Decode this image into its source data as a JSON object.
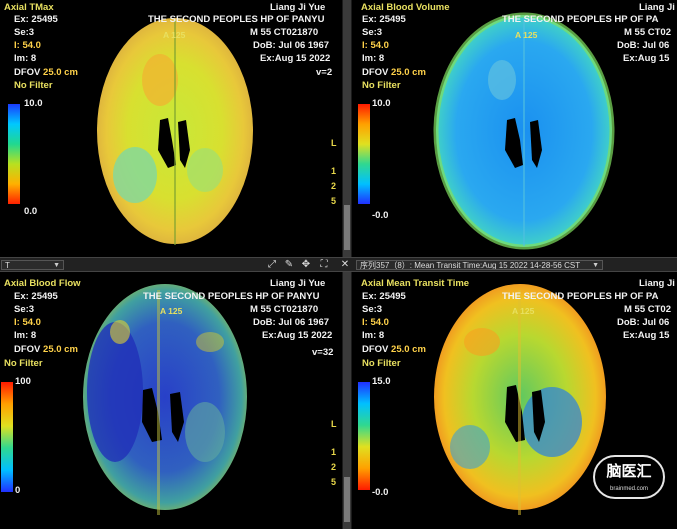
{
  "colors": {
    "text_white": "#f2f2f2",
    "text_yellow": "#e8e060"
  },
  "patient": {
    "name": "Liang Ji Yue",
    "hospital": "THE SECOND PEOPLES HP OF PANYU",
    "sex_age_id": "M  55 CT021870",
    "dob": "DoB: Jul 06 1967",
    "exam_date": "Ex:Aug 15 2022",
    "name_cut": "Liang Ji",
    "hospital_cut": "THE SECOND PEOPLES HP OF PA",
    "sex_age_id_cut": "M  55 CT02",
    "dob_cut": "DoB: Jul 06",
    "exam_date_cut": "Ex:Aug 15"
  },
  "common": {
    "ex": "Ex: 25495",
    "se": "Se:3",
    "i": "I: 54.0",
    "im": "Im: 8",
    "dfov_label": "DFOV",
    "dfov_value": "25.0 cm",
    "filter": "No Filter",
    "orient_top": "A 125"
  },
  "panels": [
    {
      "title": "Axial TMax",
      "cb_max": "10.0",
      "cb_min": "0.0",
      "v": "v=2"
    },
    {
      "title": "Axial Blood Volume",
      "cb_max": "10.0",
      "cb_min": "-0.0"
    },
    {
      "title": "Axial Blood Flow",
      "cb_max": "100",
      "cb_min": "0",
      "v": "v=32"
    },
    {
      "title": "Axial Mean Transit Time",
      "cb_max": "15.0",
      "cb_min": "-0.0"
    }
  ],
  "side_labels": {
    "l": "L",
    "n1": "1",
    "n2": "2",
    "n5": "5"
  },
  "toolbar": {
    "left_select_value": "T",
    "series_select_value": "序列357（8）: Mean Transit Time:Aug 15 2022 14-28-56 CST",
    "icons": [
      "expand-icon",
      "pencil-icon",
      "move-icon",
      "fit-icon",
      "close-icon"
    ]
  },
  "watermark": {
    "text": "脑医汇",
    "sub": "brainmed.com"
  }
}
